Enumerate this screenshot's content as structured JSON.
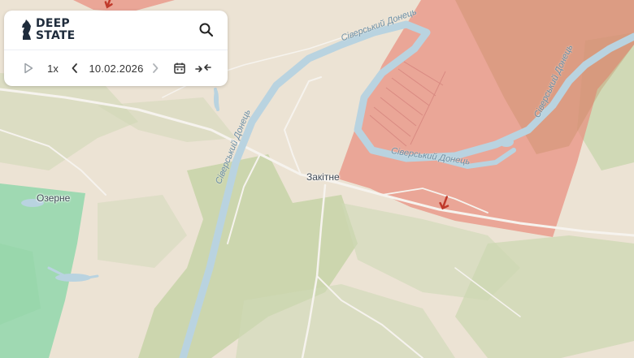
{
  "app": {
    "logo_line1": "DEEP",
    "logo_line2": "STATE"
  },
  "toolbar": {
    "speed": "1x",
    "date": "10.02.2026"
  },
  "icons": [
    "knight-logo-icon",
    "search-icon",
    "play-icon",
    "chevron-left-icon",
    "chevron-right-icon",
    "calendar-icon",
    "collapse-icon"
  ],
  "map_labels": {
    "village_main": "Закітне",
    "village_west": "Озерне",
    "river_north": "Сіверський Донець",
    "river_west": "Сіверський Донець",
    "river_center": "Сіверський Донець",
    "river_east": "Сіверський Донець"
  },
  "colors": {
    "occupied_fill": "#e98f80",
    "liberated_fill": "#6fd39c",
    "water": "#b9d3e0",
    "forest": "#c9d6ae",
    "land": "#ece3d4",
    "marker": "#c0392b"
  }
}
